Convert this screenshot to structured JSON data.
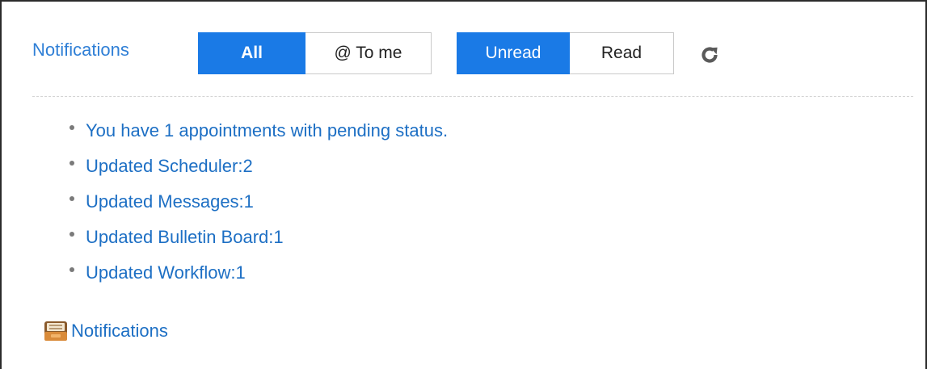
{
  "header": {
    "title": "Notifications",
    "filter_buttons": [
      {
        "label": "All",
        "active": true
      },
      {
        "label": "@ To me",
        "active": false
      }
    ],
    "read_buttons": [
      {
        "label": "Unread",
        "active": true
      },
      {
        "label": "Read",
        "active": false
      }
    ],
    "refresh_icon": "refresh-icon"
  },
  "notifications": [
    {
      "label": "You have 1 appointments with pending status."
    },
    {
      "label": "Updated Scheduler:2"
    },
    {
      "label": "Updated Messages:1"
    },
    {
      "label": "Updated Bulletin Board:1"
    },
    {
      "label": "Updated Workflow:1"
    }
  ],
  "footer": {
    "link_label": "Notifications",
    "icon": "inbox-tray-icon"
  },
  "colors": {
    "accent": "#1a7ae6",
    "link": "#1d6fc4",
    "title": "#2f7fd6"
  }
}
